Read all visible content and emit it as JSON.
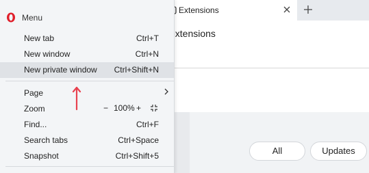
{
  "tab": {
    "title": "Extensions",
    "close_icon": "close-icon",
    "new_tab_icon": "plus-icon"
  },
  "page": {
    "heading": "extensions",
    "filters": {
      "all": "All",
      "updates": "Updates"
    }
  },
  "menu": {
    "title": "Menu",
    "logo": "opera-logo",
    "items": [
      {
        "label": "New tab",
        "shortcut": "Ctrl+T"
      },
      {
        "label": "New window",
        "shortcut": "Ctrl+N"
      },
      {
        "label": "New private window",
        "shortcut": "Ctrl+Shift+N"
      },
      {
        "label": "Page",
        "shortcut": ""
      },
      {
        "label": "Zoom",
        "shortcut": ""
      },
      {
        "label": "Find...",
        "shortcut": "Ctrl+F"
      },
      {
        "label": "Search tabs",
        "shortcut": "Ctrl+Space"
      },
      {
        "label": "Snapshot",
        "shortcut": "Ctrl+Shift+5"
      }
    ],
    "zoom": {
      "minus": "−",
      "level": "100%",
      "plus": "+"
    }
  },
  "colors": {
    "opera_red": "#e01f2b",
    "annotation_arrow": "#e8414f",
    "highlight": "#dfe2e6"
  }
}
